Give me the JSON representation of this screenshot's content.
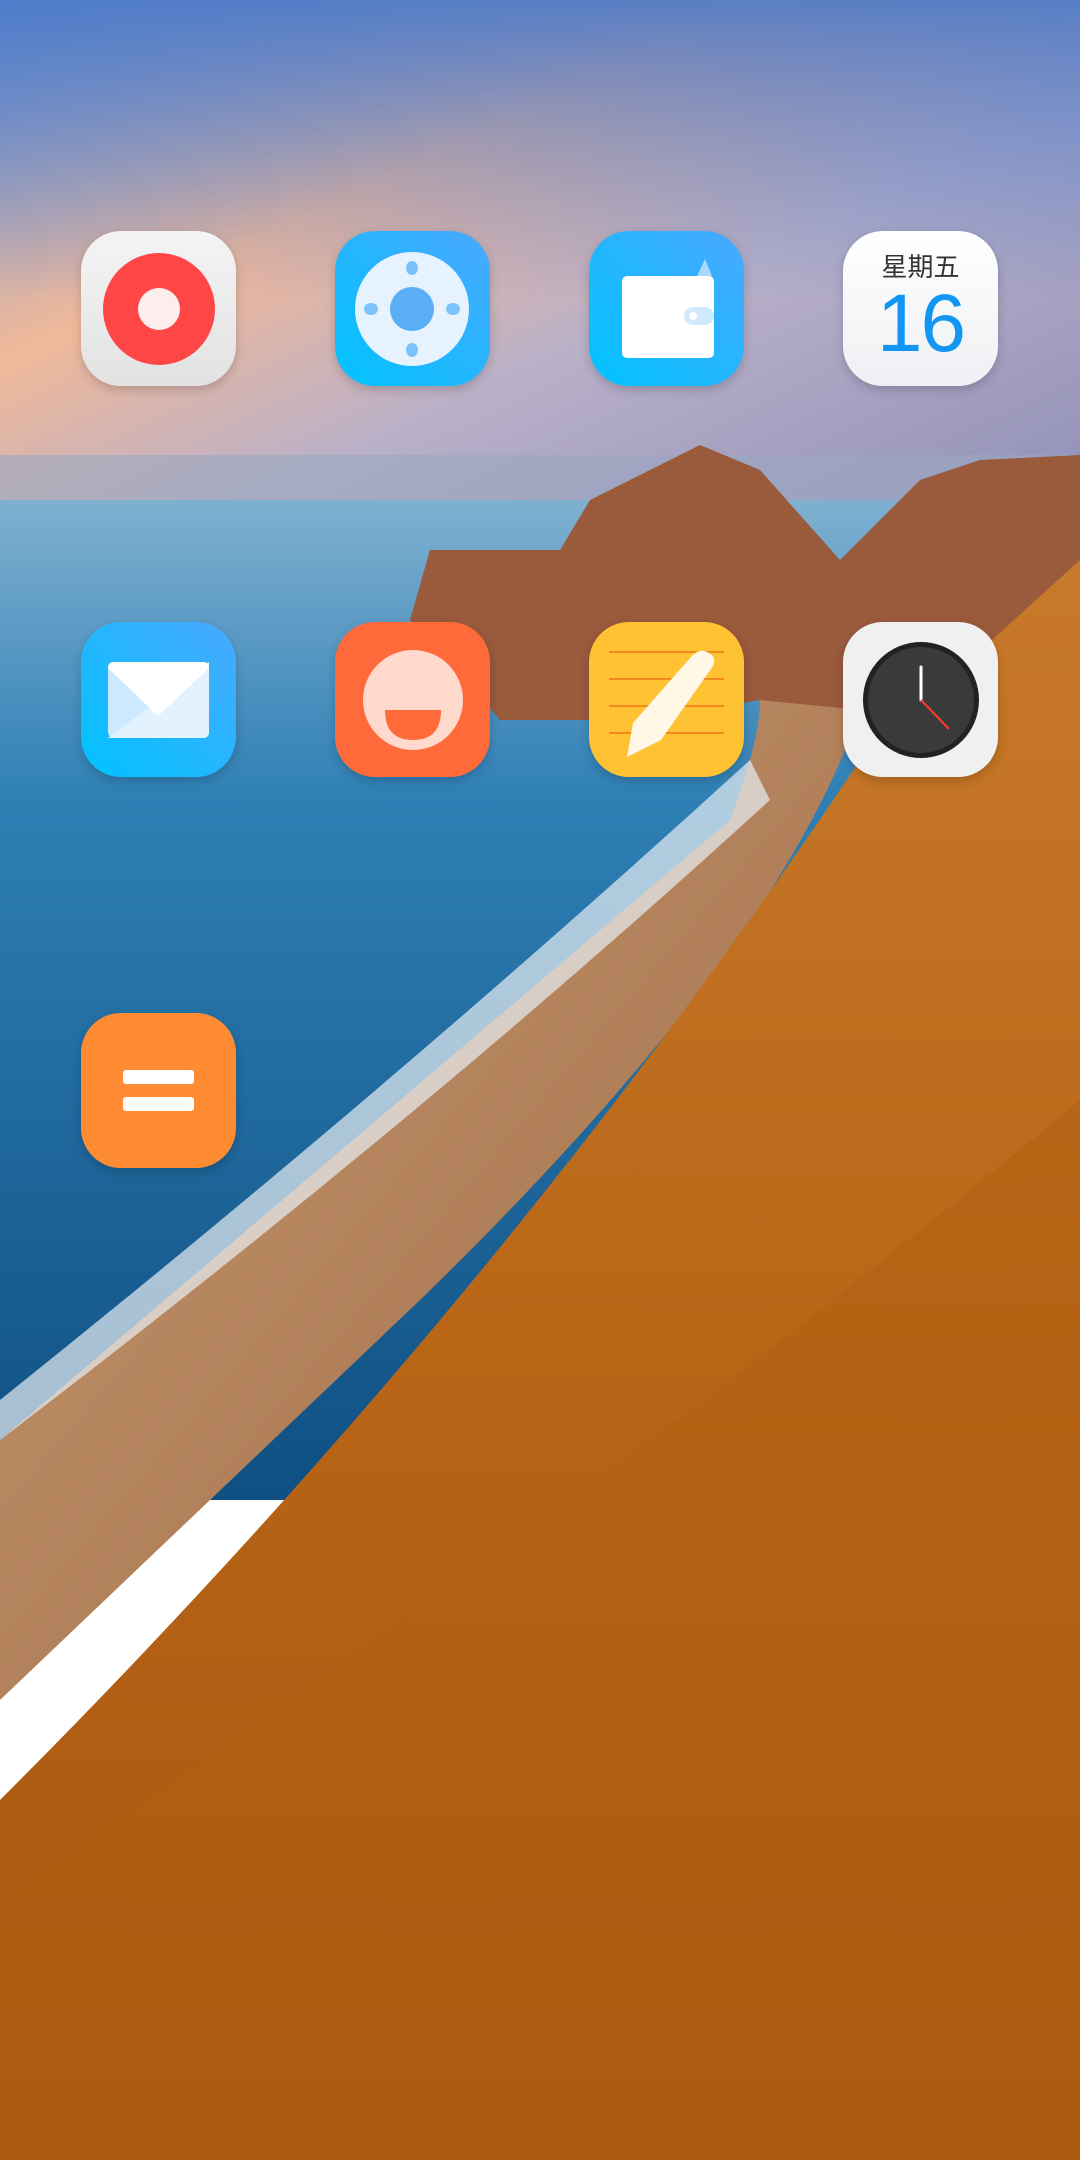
{
  "home_screen": {
    "apps": [
      {
        "row": 1,
        "col": 1,
        "icon": "screen-recorder-icon",
        "color": "#ff4646"
      },
      {
        "row": 1,
        "col": 2,
        "icon": "remote-control-icon",
        "color": "#1aa3ff"
      },
      {
        "row": 1,
        "col": 3,
        "icon": "wallet-icon",
        "color": "#1aa3ff"
      },
      {
        "row": 1,
        "col": 4,
        "icon": "calendar-icon",
        "color": "#1296f3"
      },
      {
        "row": 2,
        "col": 1,
        "icon": "mail-icon",
        "color": "#1aa3ff"
      },
      {
        "row": 2,
        "col": 2,
        "icon": "feedback-smile-icon",
        "color": "#ff6a3a"
      },
      {
        "row": 2,
        "col": 3,
        "icon": "notes-icon",
        "color": "#ffc233"
      },
      {
        "row": 2,
        "col": 4,
        "icon": "clock-icon",
        "color": "#333333"
      },
      {
        "row": 3,
        "col": 1,
        "icon": "calculator-icon",
        "color": "#ff8c33"
      }
    ],
    "calendar": {
      "weekday": "星期五",
      "day": "16"
    }
  }
}
